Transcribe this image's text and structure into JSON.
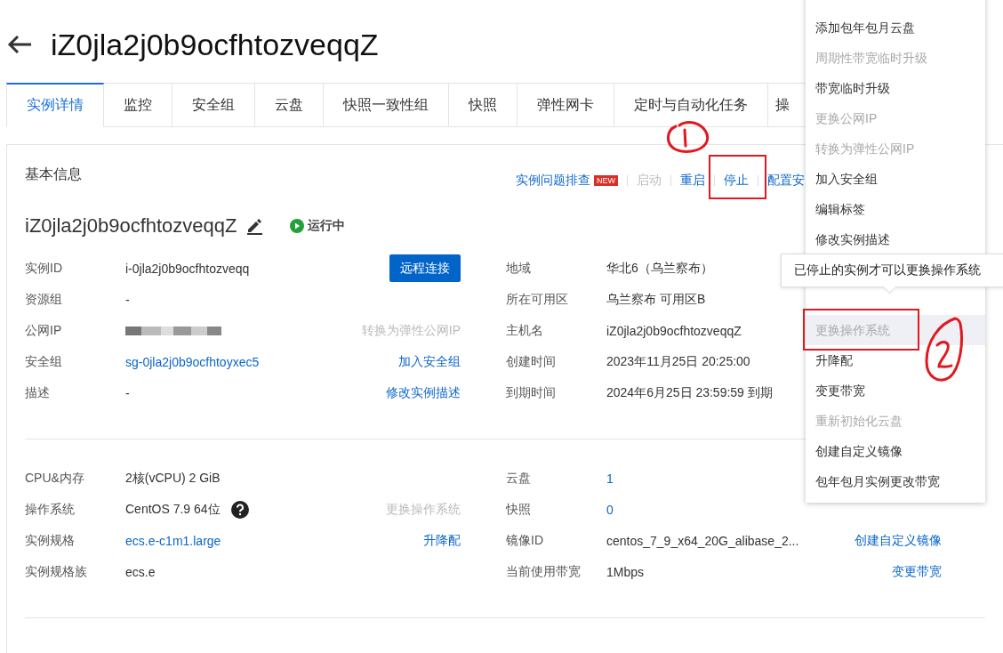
{
  "header": {
    "title": "iZ0jla2j0b9ocfhtozveqqZ"
  },
  "tabs": [
    {
      "label": "实例详情",
      "selected": true
    },
    {
      "label": "监控",
      "selected": false
    },
    {
      "label": "安全组",
      "selected": false
    },
    {
      "label": "云盘",
      "selected": false
    },
    {
      "label": "快照一致性组",
      "selected": false
    },
    {
      "label": "快照",
      "selected": false
    },
    {
      "label": "弹性网卡",
      "selected": false
    },
    {
      "label": "定时与自动化任务",
      "selected": false
    },
    {
      "label": "操",
      "selected": false
    }
  ],
  "card": {
    "title": "基本信息",
    "actions": [
      {
        "label": "实例问题排查",
        "badge": "NEW",
        "disabled": false
      },
      {
        "label": "启动",
        "disabled": true
      },
      {
        "label": "重启",
        "disabled": false
      },
      {
        "label": "停止",
        "disabled": false
      },
      {
        "label": "配置安",
        "disabled": false
      }
    ],
    "instance_name": "iZ0jla2j0b9ocfhtozveqqZ",
    "status": "运行中",
    "sections": [
      {
        "left": [
          {
            "label": "实例ID",
            "value": "i-0jla2j0b9ocfhtozveqq",
            "kind": "text",
            "action": {
              "label": "远程连接",
              "kind": "button",
              "disabled": false
            }
          },
          {
            "label": "资源组",
            "value": "-",
            "kind": "text"
          },
          {
            "label": "公网IP",
            "kind": "blurred",
            "action": {
              "label": "转换为弹性公网IP",
              "kind": "link",
              "disabled": true
            }
          },
          {
            "label": "安全组",
            "value": "sg-0jla2j0b9ocfhtoyxec5",
            "kind": "link",
            "action": {
              "label": "加入安全组",
              "kind": "link",
              "disabled": false
            }
          },
          {
            "label": "描述",
            "value": "-",
            "kind": "text",
            "action": {
              "label": "修改实例描述",
              "kind": "link",
              "disabled": false
            }
          }
        ],
        "right": [
          {
            "label": "地域",
            "value": "华北6（乌兰察布）",
            "kind": "text"
          },
          {
            "label": "所在可用区",
            "value": "乌兰察布 可用区B",
            "kind": "text"
          },
          {
            "label": "主机名",
            "value": "iZ0jla2j0b9ocfhtozveqqZ",
            "kind": "text"
          },
          {
            "label": "创建时间",
            "value": "2023年11月25日 20:25:00",
            "kind": "text"
          },
          {
            "label": "到期时间",
            "value": "2024年6月25日 23:59:59 到期",
            "kind": "text"
          }
        ]
      },
      {
        "left": [
          {
            "label": "CPU&内存",
            "value": "2核(vCPU) 2 GiB",
            "kind": "text"
          },
          {
            "label": "操作系统",
            "value": "CentOS 7.9 64位",
            "kind": "text",
            "help": true,
            "action": {
              "label": "更换操作系统",
              "kind": "link",
              "disabled": true
            }
          },
          {
            "label": "实例规格",
            "value": "ecs.e-c1m1.large",
            "kind": "link",
            "action": {
              "label": "升降配",
              "kind": "link",
              "disabled": false
            }
          },
          {
            "label": "实例规格族",
            "value": "ecs.e",
            "kind": "text"
          }
        ],
        "right": [
          {
            "label": "云盘",
            "value": "1",
            "kind": "link"
          },
          {
            "label": "快照",
            "value": "0",
            "kind": "link"
          },
          {
            "label": "镜像ID",
            "value": "centos_7_9_x64_20G_alibase_2...",
            "kind": "text",
            "action": {
              "label": "创建自定义镜像",
              "kind": "link",
              "disabled": false
            }
          },
          {
            "label": "当前使用带宽",
            "value": "1Mbps",
            "kind": "text",
            "action": {
              "label": "变更带宽",
              "kind": "link",
              "disabled": false
            }
          }
        ]
      }
    ]
  },
  "menu": {
    "items_top": [
      {
        "label": "添加包年包月云盘",
        "disabled": false,
        "highlighted": false
      },
      {
        "label": "周期性带宽临时升级",
        "disabled": true,
        "highlighted": false
      },
      {
        "label": "带宽临时升级",
        "disabled": false,
        "highlighted": false
      },
      {
        "label": "更换公网IP",
        "disabled": true,
        "highlighted": false
      },
      {
        "label": "转换为弹性公网IP",
        "disabled": true,
        "highlighted": false
      },
      {
        "label": "加入安全组",
        "disabled": false,
        "highlighted": false
      },
      {
        "label": "编辑标签",
        "disabled": false,
        "highlighted": false
      },
      {
        "label": "修改实例描述",
        "disabled": false,
        "highlighted": false
      }
    ],
    "items_bottom": [
      {
        "label": "更换操作系统",
        "disabled": true,
        "highlighted": true
      },
      {
        "label": "升降配",
        "disabled": false,
        "highlighted": false
      },
      {
        "label": "变更带宽",
        "disabled": false,
        "highlighted": false
      },
      {
        "label": "重新初始化云盘",
        "disabled": true,
        "highlighted": false
      },
      {
        "label": "创建自定义镜像",
        "disabled": false,
        "highlighted": false
      },
      {
        "label": "包年包月实例更改带宽",
        "disabled": false,
        "highlighted": false
      }
    ]
  },
  "tooltip": {
    "text": "已停止的实例才可以更换操作系统"
  }
}
